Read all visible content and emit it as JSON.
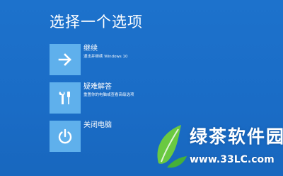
{
  "title": "选择一个选项",
  "options": [
    {
      "icon": "arrow-right-icon",
      "label": "继续",
      "desc": "退出并继续 Windows 10"
    },
    {
      "icon": "tools-icon",
      "label": "疑难解答",
      "desc": "重置你的电脑或查看高级选项"
    },
    {
      "icon": "power-icon",
      "label": "关闭电脑",
      "desc": ""
    }
  ],
  "watermark": {
    "brand": "绿茶软件园",
    "url": "www.33LC.com"
  },
  "colors": {
    "background": "#1a6dc9",
    "tile": "#5fb0ec",
    "text": "#ffffff"
  }
}
